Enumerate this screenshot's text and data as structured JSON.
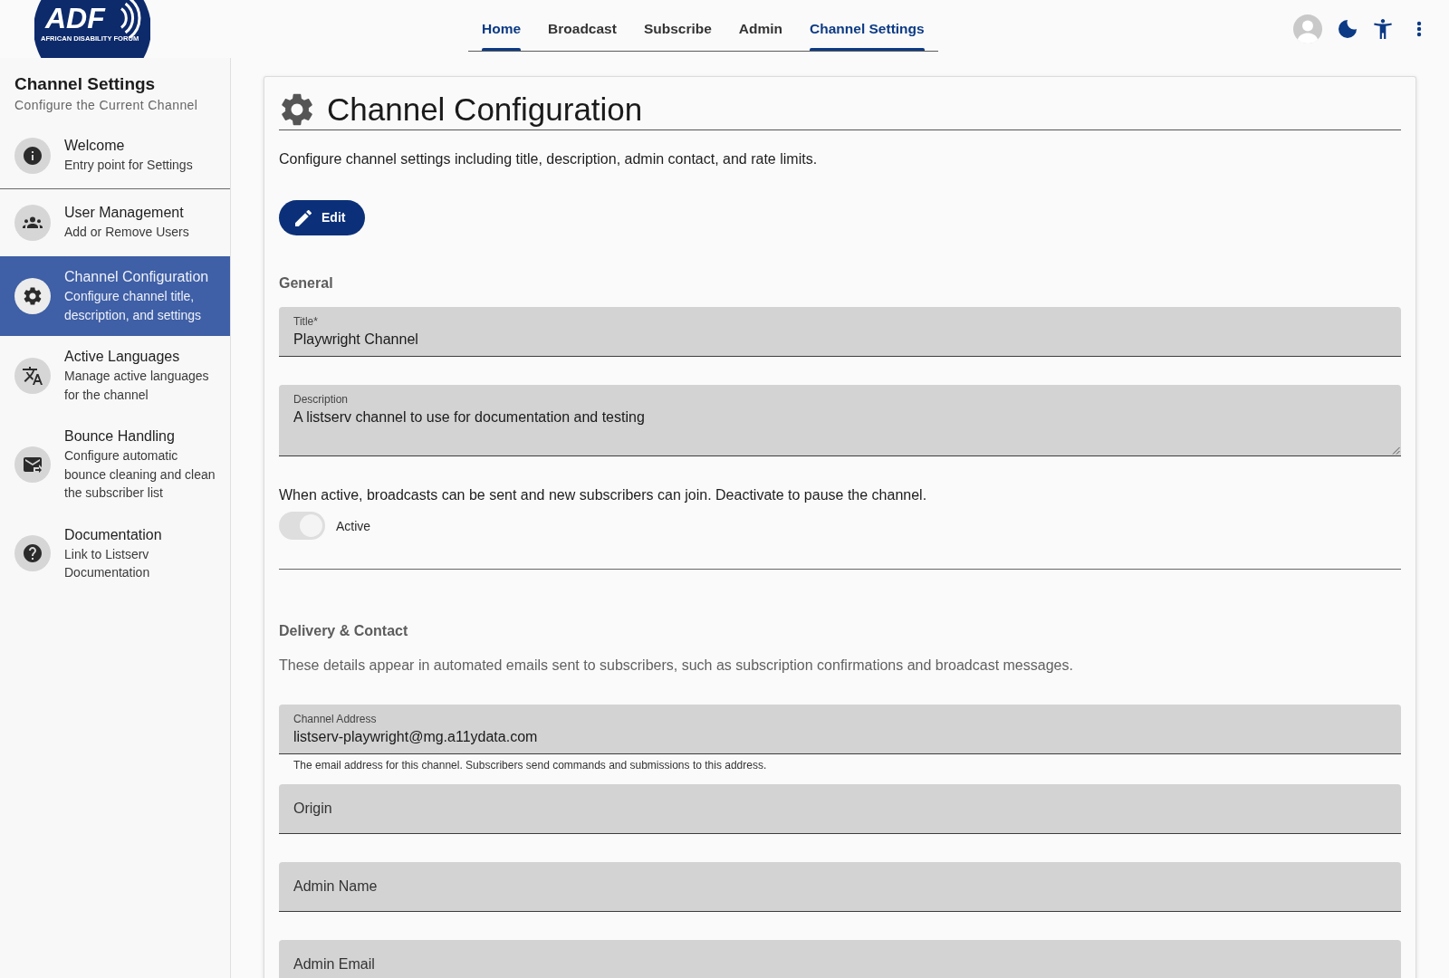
{
  "logo": {
    "text": "ADF",
    "tagline": "AFRICAN DISABILITY FORUM"
  },
  "nav": {
    "tabs": [
      {
        "label": "Home",
        "selected": true
      },
      {
        "label": "Broadcast",
        "selected": false
      },
      {
        "label": "Subscribe",
        "selected": false
      },
      {
        "label": "Admin",
        "selected": false
      },
      {
        "label": "Channel Settings",
        "selected": true
      }
    ]
  },
  "sidebar": {
    "title": "Channel Settings",
    "subtitle": "Configure the Current Channel",
    "items": [
      {
        "title": "Welcome",
        "subtitle": "Entry point for Settings",
        "selected": false,
        "divider_below": true
      },
      {
        "title": "User Management",
        "subtitle": "Add or Remove Users",
        "selected": false,
        "divider_below": false
      },
      {
        "title": "Channel Configuration",
        "subtitle": "Configure channel title, description, and settings",
        "selected": true,
        "divider_below": false
      },
      {
        "title": "Active Languages",
        "subtitle": "Manage active languages for the channel",
        "selected": false,
        "divider_below": false
      },
      {
        "title": "Bounce Handling",
        "subtitle": "Configure automatic bounce cleaning and clean the subscriber list",
        "selected": false,
        "divider_below": false
      },
      {
        "title": "Documentation",
        "subtitle": "Link to Listserv Documentation",
        "selected": false,
        "divider_below": false
      }
    ]
  },
  "main": {
    "title": "Channel Configuration",
    "description": "Configure channel settings including title, description, admin contact, and rate limits.",
    "edit_button": "Edit",
    "sections": [
      {
        "heading": "General",
        "items": [
          {
            "kind": "field",
            "label": "Title*",
            "value": "Playwright Channel"
          },
          {
            "kind": "textarea",
            "label": "Description",
            "value": "A listserv channel to use for documentation and testing"
          },
          {
            "kind": "note",
            "text": "When active, broadcasts can be sent and new subscribers can join. Deactivate to pause the channel."
          },
          {
            "kind": "toggle",
            "label": "Active",
            "on": true,
            "disabled": true
          }
        ]
      },
      {
        "heading": "Delivery & Contact",
        "items": [
          {
            "kind": "intro",
            "text": "These details appear in automated emails sent to subscribers, such as subscription confirmations and broadcast messages."
          },
          {
            "kind": "field",
            "label": "Channel Address",
            "value": "listserv-playwright@mg.a11ydata.com",
            "helper": "The email address for this channel. Subscribers send commands and submissions to this address."
          },
          {
            "kind": "field",
            "label": "Origin"
          },
          {
            "kind": "field",
            "label": "Admin Name"
          },
          {
            "kind": "field",
            "label": "Admin Email"
          }
        ]
      }
    ]
  }
}
